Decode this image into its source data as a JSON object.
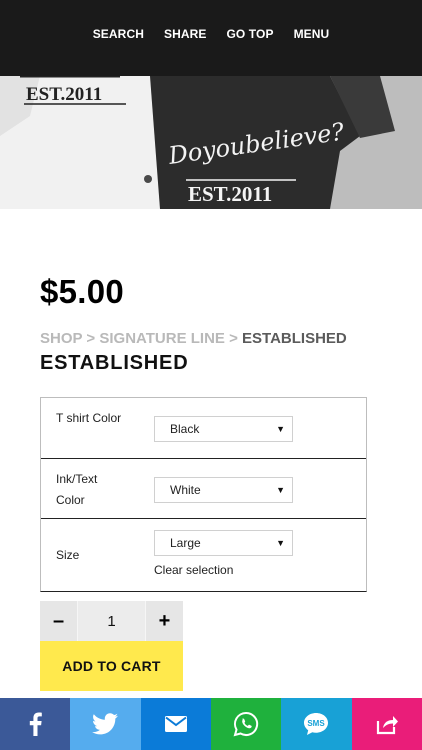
{
  "nav": {
    "items": [
      "SEARCH",
      "SHARE",
      "GO TOP",
      "MENU"
    ]
  },
  "hero": {
    "print_text_left": "EST.2011",
    "print_text_right": "EST.2011",
    "script_text": "Doyoubelieve?",
    "alt": "t-shirt photo"
  },
  "product": {
    "price": "$5.00",
    "breadcrumb": {
      "shop": "SHOP",
      "category": "SIGNATURE LINE",
      "current": "ESTABLISHED",
      "separator": ">"
    },
    "title": "ESTABLISHED"
  },
  "variations": [
    {
      "label": "T shirt Color",
      "value": "Black"
    },
    {
      "label": "Ink/Text Color",
      "value": "White"
    },
    {
      "label": "Size",
      "value": "Large"
    }
  ],
  "clear_selection": "Clear selection",
  "quantity": {
    "minus": "–",
    "value": "1",
    "plus": "+"
  },
  "add_to_cart": "ADD TO CART",
  "share_bar": [
    {
      "name": "facebook",
      "color": "#3b5998",
      "icon": "facebook-icon"
    },
    {
      "name": "twitter",
      "color": "#55acee",
      "icon": "twitter-icon"
    },
    {
      "name": "email",
      "color": "#0b7bd8",
      "icon": "mail-icon"
    },
    {
      "name": "whatsapp",
      "color": "#1fb13d",
      "icon": "whatsapp-icon"
    },
    {
      "name": "sms",
      "color": "#18a1d6",
      "icon": "sms-icon",
      "label": "SMS"
    },
    {
      "name": "share",
      "color": "#ea1d79",
      "icon": "share-icon"
    }
  ],
  "colors": {
    "topbar": "#1a1a1a",
    "add_to_cart_bg": "#ffe94d",
    "breadcrumb_gray": "#b9b9b9"
  }
}
